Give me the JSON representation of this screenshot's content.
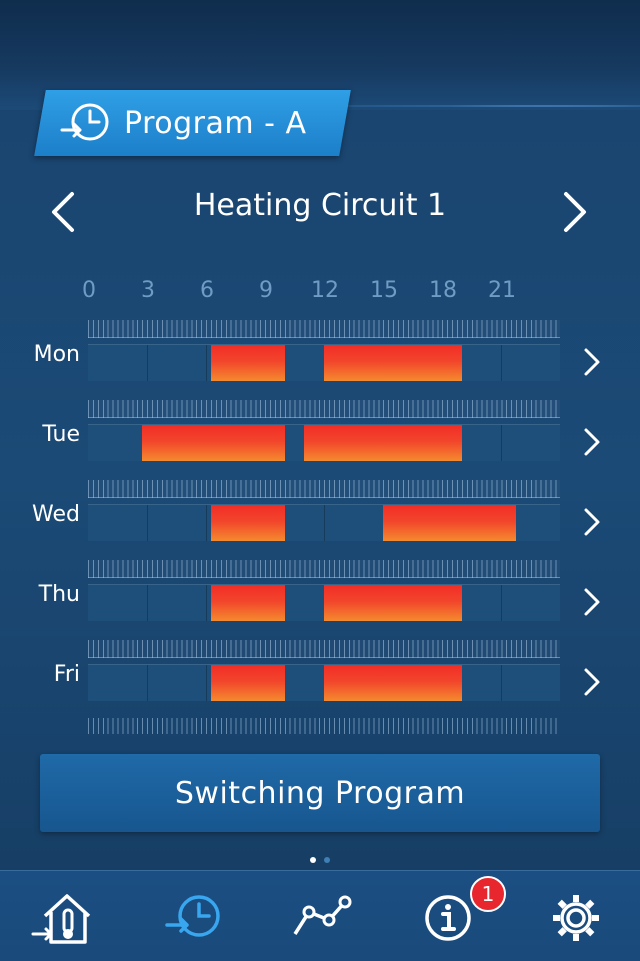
{
  "header": {
    "program_title": "Program - A",
    "program_icon": "clock-arrow-icon"
  },
  "circuit": {
    "title": "Heating Circuit 1",
    "prev_icon": "chevron-left-icon",
    "next_icon": "chevron-right-icon"
  },
  "hour_axis": [
    "0",
    "3",
    "6",
    "9",
    "12",
    "15",
    "18",
    "21"
  ],
  "schedule": [
    {
      "day": "Mon",
      "segments": [
        [
          6.25,
          10
        ],
        [
          12,
          19
        ]
      ]
    },
    {
      "day": "Tue",
      "segments": [
        [
          2.75,
          10
        ],
        [
          11,
          19
        ]
      ]
    },
    {
      "day": "Wed",
      "segments": [
        [
          6.25,
          10
        ],
        [
          15,
          21.75
        ]
      ]
    },
    {
      "day": "Thu",
      "segments": [
        [
          6.25,
          10
        ],
        [
          12,
          19
        ]
      ]
    },
    {
      "day": "Fri",
      "segments": [
        [
          6.25,
          10
        ],
        [
          12,
          19
        ]
      ]
    }
  ],
  "switch_button": {
    "label": "Switching Program"
  },
  "pager": {
    "pages": 2,
    "current": 1
  },
  "tabbar": {
    "items": [
      {
        "name": "home-temperature-icon"
      },
      {
        "name": "clock-arrow-icon",
        "active": true
      },
      {
        "name": "graph-icon"
      },
      {
        "name": "info-icon"
      },
      {
        "name": "gear-icon"
      }
    ],
    "info_badge": "1"
  },
  "colors": {
    "accent": "#2f9fe6",
    "heating_top": "#f12d26",
    "heating_bottom": "#f48a2e",
    "badge": "#e8262d"
  }
}
